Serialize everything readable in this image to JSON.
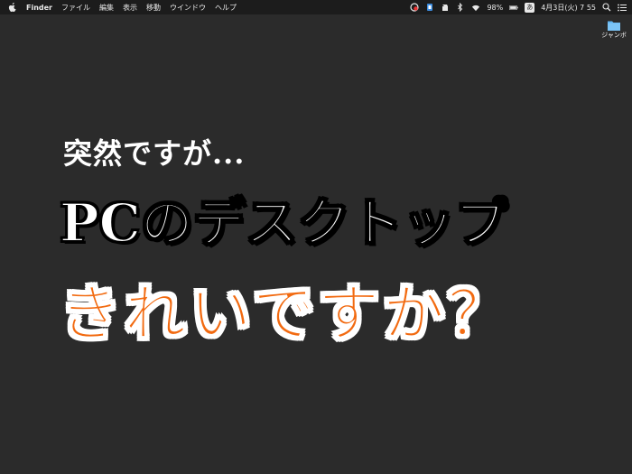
{
  "menubar": {
    "app_name": "Finder",
    "items": [
      "ファイル",
      "編集",
      "表示",
      "移動",
      "ウインドウ",
      "ヘルプ"
    ],
    "battery": "98%",
    "input_method": "あ",
    "datetime": "4月3日(火) 7 55"
  },
  "desktop": {
    "icon_label": "ジャンボ"
  },
  "headline": {
    "line1": "突然ですが...",
    "line2": "PCのデスクトップ",
    "line3": "きれいですか？"
  },
  "colors": {
    "background": "#2b2b2b",
    "menubar": "#1c1c1c",
    "accent_orange": "#f26a10",
    "folder_blue": "#5eb3f0"
  }
}
